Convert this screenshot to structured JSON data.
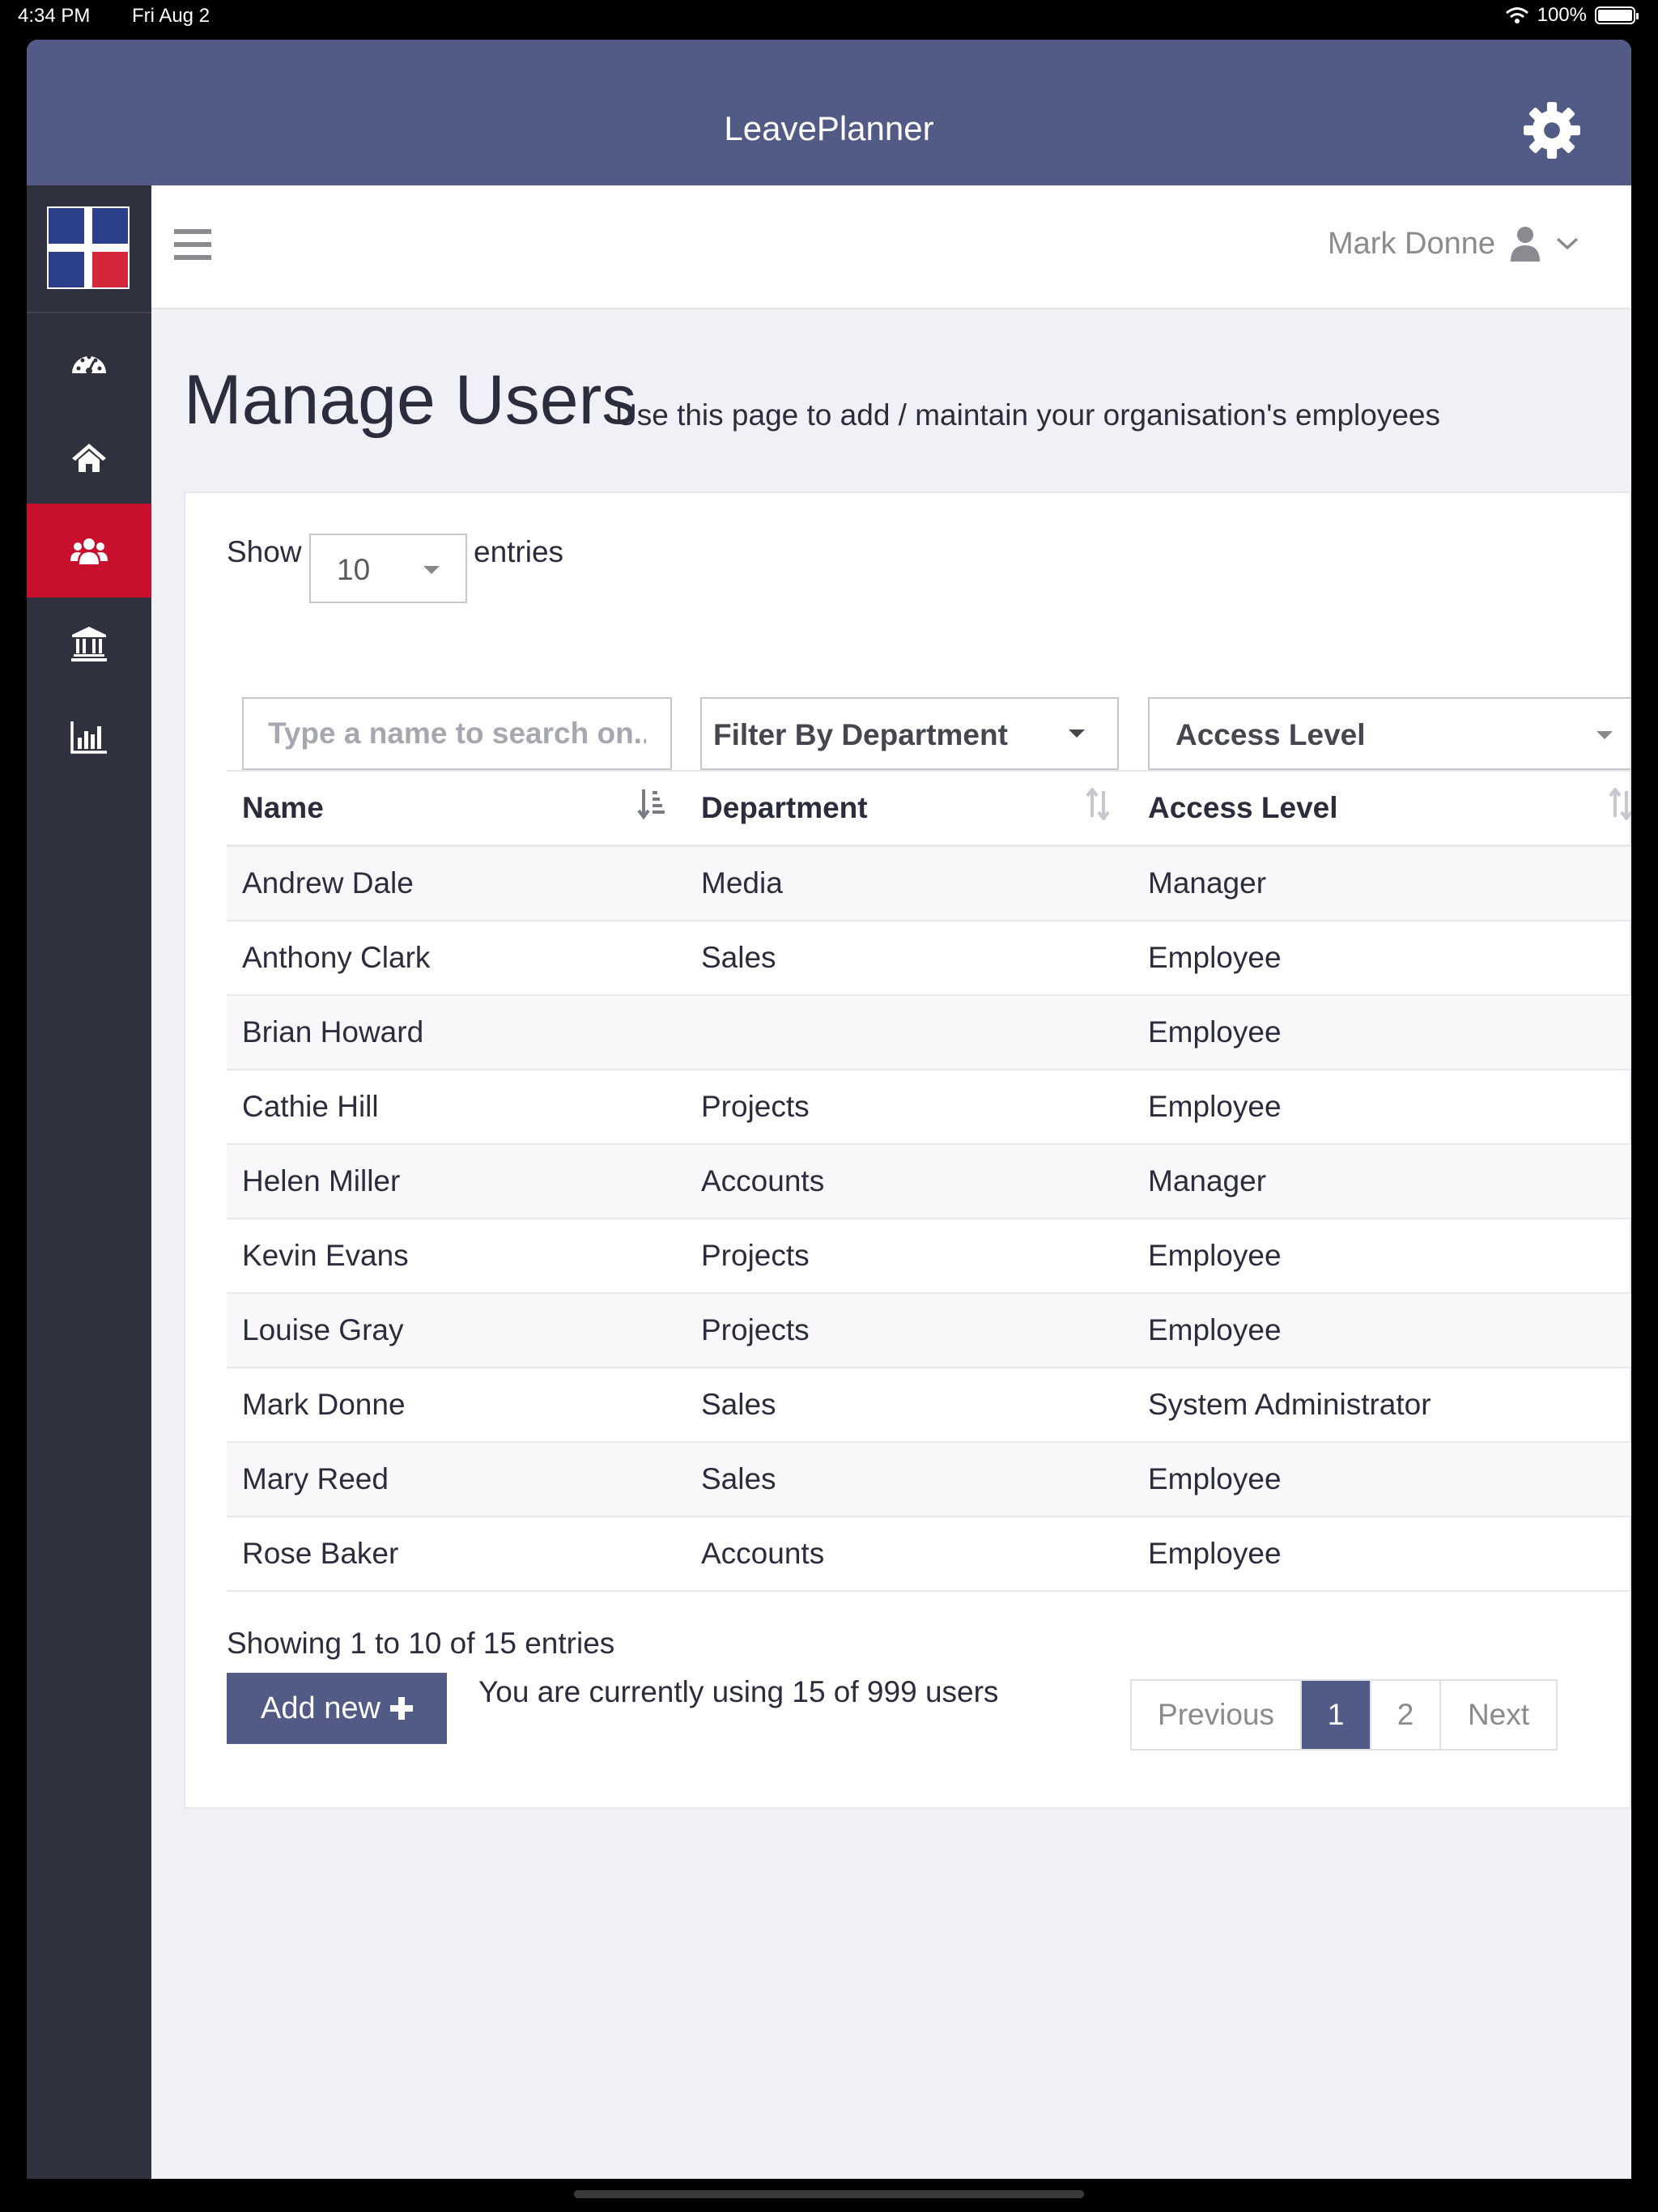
{
  "status": {
    "time": "4:34 PM",
    "date": "Fri Aug 2",
    "battery": "100%",
    "battery_level": 1.0
  },
  "app": {
    "title": "LeavePlanner"
  },
  "sidebar": {
    "items": [
      {
        "icon": "dashboard-icon",
        "active": false
      },
      {
        "icon": "home-icon",
        "active": false
      },
      {
        "icon": "users-icon",
        "active": true
      },
      {
        "icon": "bank-icon",
        "active": false
      },
      {
        "icon": "bar-chart-icon",
        "active": false
      }
    ]
  },
  "header": {
    "user_name": "Mark Donne"
  },
  "page": {
    "title": "Manage Users",
    "subtitle": "Use this page to add / maintain your organisation's employees"
  },
  "length": {
    "show": "Show",
    "value": "10",
    "entries": "entries"
  },
  "filters": {
    "search_placeholder": "Type a name to search on...",
    "department": "Filter By Department",
    "access": "Access Level"
  },
  "table": {
    "columns": [
      "Name",
      "Department",
      "Access Level"
    ],
    "rows": [
      {
        "name": "Andrew Dale",
        "department": "Media",
        "access": "Manager"
      },
      {
        "name": "Anthony Clark",
        "department": "Sales",
        "access": "Employee"
      },
      {
        "name": "Brian Howard",
        "department": "",
        "access": "Employee"
      },
      {
        "name": "Cathie Hill",
        "department": "Projects",
        "access": "Employee"
      },
      {
        "name": "Helen Miller",
        "department": "Accounts",
        "access": "Manager"
      },
      {
        "name": "Kevin Evans",
        "department": "Projects",
        "access": "Employee"
      },
      {
        "name": "Louise Gray",
        "department": "Projects",
        "access": "Employee"
      },
      {
        "name": "Mark Donne",
        "department": "Sales",
        "access": "System Administrator"
      },
      {
        "name": "Mary Reed",
        "department": "Sales",
        "access": "Employee"
      },
      {
        "name": "Rose Baker",
        "department": "Accounts",
        "access": "Employee"
      }
    ]
  },
  "footer": {
    "info": "Showing 1 to 10 of 15 entries",
    "add_label": "Add new",
    "usage": "You are currently using 15 of 999 users",
    "pager": {
      "previous": "Previous",
      "page1": "1",
      "page2": "2",
      "next": "Next"
    }
  },
  "colors": {
    "brand": "#525a86",
    "active": "#c8102e",
    "sidebar": "#30313e"
  }
}
